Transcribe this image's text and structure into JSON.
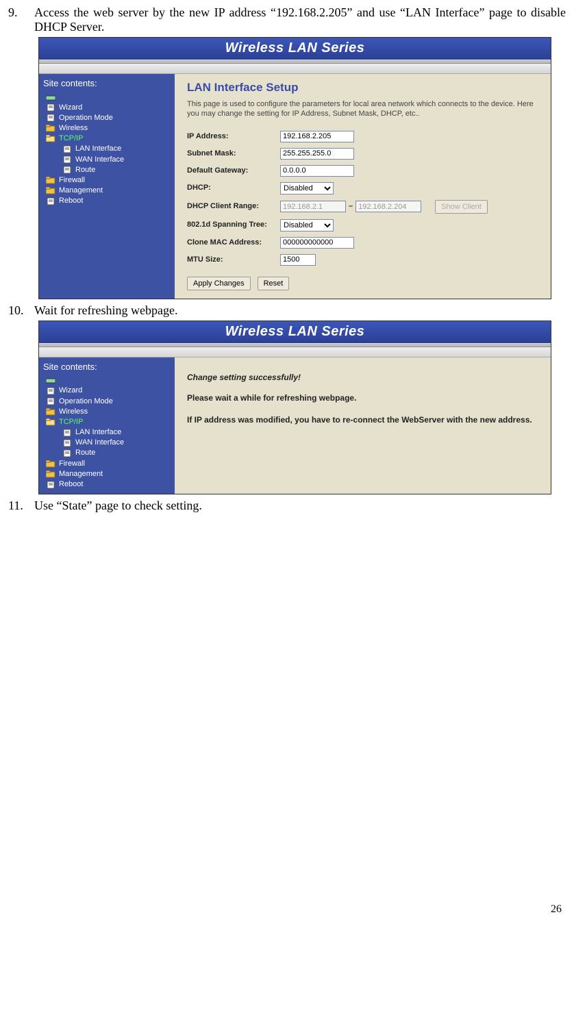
{
  "doc": {
    "step9_num": "9.",
    "step9_text": "Access the web server by the new IP address “192.168.2.205” and use “LAN Interface” page to disable DHCP Server.",
    "step10_num": "10.",
    "step10_text": "Wait for refreshing webpage.",
    "step11_num": "11.",
    "step11_text": "Use “State” page to check setting.",
    "page_number": "26"
  },
  "router": {
    "title": "Wireless LAN Series",
    "sidebar_title": "Site contents:",
    "tree": {
      "wizard": "Wizard",
      "opmode": "Operation Mode",
      "wireless": "Wireless",
      "tcpip": "TCP/IP",
      "lan": "LAN Interface",
      "wan": "WAN Interface",
      "route": "Route",
      "firewall": "Firewall",
      "management": "Management",
      "reboot": "Reboot"
    }
  },
  "lanpage": {
    "heading": "LAN Interface Setup",
    "desc": "This page is used to configure the parameters for local area network which connects to the device. Here you may change the setting for IP Address, Subnet Mask, DHCP, etc..",
    "labels": {
      "ip": "IP Address:",
      "subnet": "Subnet Mask:",
      "gateway": "Default Gateway:",
      "dhcp": "DHCP:",
      "range": "DHCP Client Range:",
      "spanning": "802.1d Spanning Tree:",
      "clone": "Clone MAC Address:",
      "mtu": "MTU Size:"
    },
    "values": {
      "ip": "192.168.2.205",
      "subnet": "255.255.255.0",
      "gateway": "0.0.0.0",
      "dhcp": "Disabled",
      "range_start": "192.168.2.1",
      "range_end": "192.168.2.204",
      "spanning": "Disabled",
      "clone": "000000000000",
      "mtu": "1500"
    },
    "buttons": {
      "showclient": "Show Client",
      "apply": "Apply Changes",
      "reset": "Reset"
    }
  },
  "refresh": {
    "line1": "Change setting successfully!",
    "line2": "Please wait a while for refreshing webpage.",
    "line3": "If IP address was modified, you have to re-connect the WebServer with the new address."
  }
}
